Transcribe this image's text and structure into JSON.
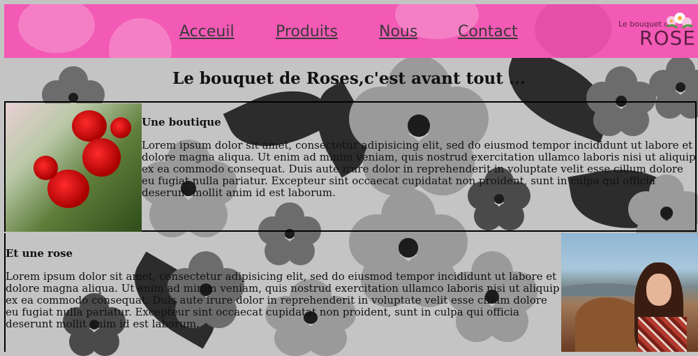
{
  "header": {
    "nav": [
      {
        "label": "Acceuil"
      },
      {
        "label": "Produits"
      },
      {
        "label": "Nous"
      },
      {
        "label": "Contact"
      }
    ],
    "logo": {
      "small_text": "Le bouquet de",
      "big_text": "ROSE"
    }
  },
  "main": {
    "title": "Le bouquet de Roses,c'est avant tout ...",
    "section1": {
      "heading": "Une boutique",
      "body": "Lorem ipsum dolor sit amet, consectetur adipisicing elit, sed do eiusmod tempor incididunt ut labore et dolore magna aliqua. Ut enim ad minim veniam, quis nostrud exercitation ullamco laboris nisi ut aliquip ex ea commodo consequat. Duis aute irure dolor in reprehenderit in voluptate velit esse cillum dolore eu fugiat nulla pariatur. Excepteur sint occaecat cupidatat non proident, sunt in culpa qui officia deserunt mollit anim id est laborum."
    },
    "section2": {
      "heading": "Et une rose",
      "body": "Lorem ipsum dolor sit amet, consectetur adipisicing elit, sed do eiusmod tempor incididunt ut labore et dolore magna aliqua. Ut enim ad minim veniam, quis nostrud exercitation ullamco laboris nisi ut aliquip ex ea commodo consequat. Duis aute irure dolor in reprehenderit in voluptate velit esse cillum dolore eu fugiat nulla pariatur. Excepteur sint occaecat cupidatat non proident, sunt in culpa qui officia deserunt mollit anim id est laborum."
    }
  },
  "colors": {
    "header_background": "#f25ab5",
    "page_background": "#c4c4c4",
    "logo_text": "#5a1e44"
  }
}
